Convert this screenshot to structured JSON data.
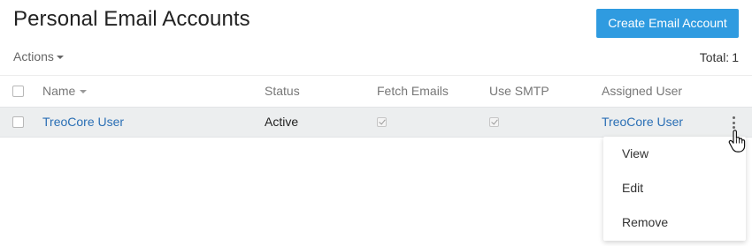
{
  "header": {
    "title": "Personal Email Accounts",
    "create_label": "Create Email Account"
  },
  "toolbar": {
    "actions_label": "Actions",
    "total_label": "Total:",
    "total_value": "1"
  },
  "table": {
    "columns": [
      "Name",
      "Status",
      "Fetch Emails",
      "Use SMTP",
      "Assigned User"
    ],
    "rows": [
      {
        "name": "TreoCore User",
        "status": "Active",
        "fetch_emails": true,
        "use_smtp": true,
        "assigned_user": "TreoCore User"
      }
    ]
  },
  "row_menu": {
    "items": [
      "View",
      "Edit",
      "Remove"
    ]
  },
  "colors": {
    "accent": "#2f9be0",
    "link": "#2a6fb5",
    "row_highlight": "#eceeef"
  },
  "icons": {
    "row_actions": "kebab-vertical-icon",
    "pointer": "hand-cursor-icon"
  }
}
